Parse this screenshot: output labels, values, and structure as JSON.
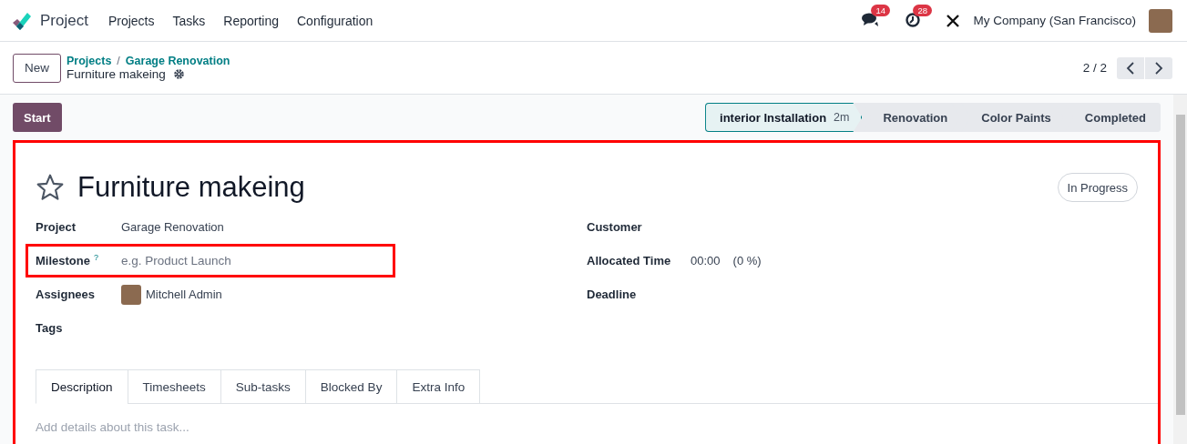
{
  "app": {
    "name": "Project"
  },
  "menu": [
    {
      "label": "Projects"
    },
    {
      "label": "Tasks"
    },
    {
      "label": "Reporting"
    },
    {
      "label": "Configuration"
    }
  ],
  "systray": {
    "messages_badge": "14",
    "activities_badge": "28",
    "company": "My Company (San Francisco)"
  },
  "control_panel": {
    "new_button": "New",
    "breadcrumb_separator": "/",
    "breadcrumbs": [
      {
        "label": "Projects"
      },
      {
        "label": "Garage Renovation"
      }
    ],
    "record_title": "Furniture makeing",
    "pager": "2 / 2"
  },
  "start_button": "Start",
  "stages": [
    {
      "label": "interior Installation",
      "duration": "2m",
      "selected": true
    },
    {
      "label": "Renovation",
      "selected": false
    },
    {
      "label": "Color Paints",
      "selected": false
    },
    {
      "label": "Completed",
      "selected": false
    }
  ],
  "form": {
    "title": "Furniture makeing",
    "starred": false,
    "state": "In Progress",
    "left_fields": [
      {
        "label": "Project",
        "value": "Garage Renovation",
        "kind": "text"
      },
      {
        "label": "Milestone",
        "help": "?",
        "placeholder": "e.g. Product Launch",
        "kind": "input",
        "highlighted": true
      },
      {
        "label": "Assignees",
        "value": "Mitchell Admin",
        "kind": "user"
      },
      {
        "label": "Tags",
        "kind": "empty"
      }
    ],
    "right_fields": [
      {
        "label": "Customer",
        "kind": "empty"
      },
      {
        "label": "Allocated Time",
        "value": "00:00",
        "extra": "(0 %)",
        "kind": "time"
      },
      {
        "label": "Deadline",
        "kind": "empty"
      }
    ],
    "tabs": [
      {
        "label": "Description",
        "selected": true
      },
      {
        "label": "Timesheets",
        "selected": false
      },
      {
        "label": "Sub-tasks",
        "selected": false
      },
      {
        "label": "Blocked By",
        "selected": false
      },
      {
        "label": "Extra Info",
        "selected": false
      }
    ],
    "description_placeholder": "Add details about this task..."
  }
}
